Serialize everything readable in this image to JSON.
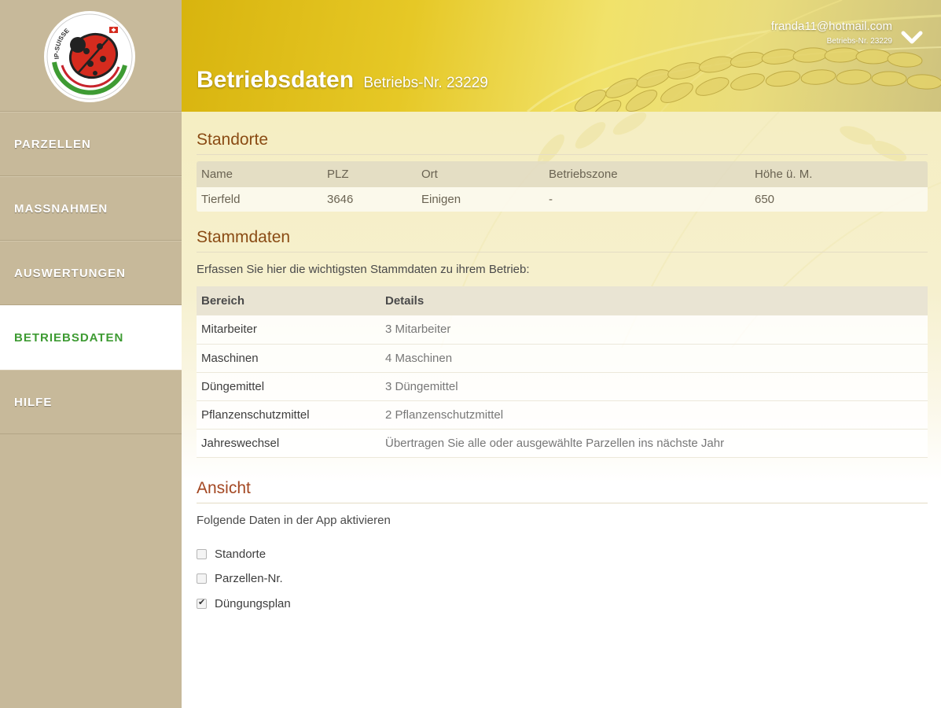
{
  "sidebar": {
    "items": [
      {
        "label": "PARZELLEN"
      },
      {
        "label": "MASSNAHMEN"
      },
      {
        "label": "AUSWERTUNGEN"
      },
      {
        "label": "BETRIEBSDATEN",
        "active": true
      },
      {
        "label": "HILFE"
      }
    ],
    "logo": {
      "text": "IP-SUISSE",
      "icon": "ladybug-icon"
    }
  },
  "header": {
    "title": "Betriebsdaten",
    "subtitle": "Betriebs-Nr. 23229",
    "user": {
      "email": "franda11@hotmail.com",
      "betrieb_nr": "Betriebs-Nr. 23229",
      "toggle_icon": "chevron-down-icon"
    }
  },
  "standorte": {
    "title": "Standorte",
    "columns": [
      "Name",
      "PLZ",
      "Ort",
      "Betriebszone",
      "Höhe ü. M."
    ],
    "rows": [
      [
        "Tierfeld",
        "3646",
        "Einigen",
        "-",
        "650"
      ]
    ]
  },
  "stammdaten": {
    "title": "Stammdaten",
    "description": "Erfassen Sie hier die wichtigsten Stammdaten zu ihrem Betrieb:",
    "columns": [
      "Bereich",
      "Details"
    ],
    "rows": [
      [
        "Mitarbeiter",
        "3 Mitarbeiter"
      ],
      [
        "Maschinen",
        "4 Maschinen"
      ],
      [
        "Düngemittel",
        "3 Düngemittel"
      ],
      [
        "Pflanzenschutzmittel",
        "2 Pflanzenschutzmittel"
      ],
      [
        "Jahreswechsel",
        "Übertragen Sie alle oder ausgewählte Parzellen ins nächste Jahr"
      ]
    ]
  },
  "ansicht": {
    "title": "Ansicht",
    "description": "Folgende Daten in der App aktivieren",
    "options": [
      {
        "label": "Standorte",
        "checked": false
      },
      {
        "label": "Parzellen-Nr.",
        "checked": false
      },
      {
        "label": "Düngungsplan",
        "checked": true
      }
    ]
  },
  "colors": {
    "sidebar": "#c7b99a",
    "active_nav": "#3e9b33",
    "section_title": "#8a4b14",
    "ansicht_title": "#a34722"
  }
}
